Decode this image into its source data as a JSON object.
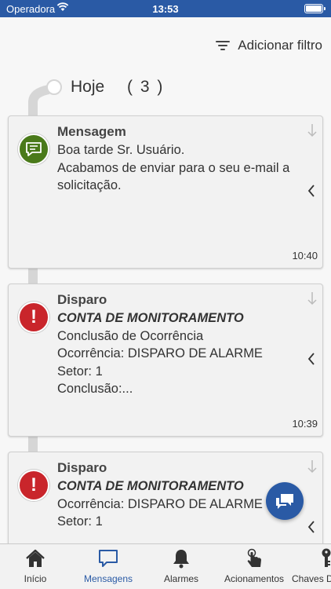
{
  "status_bar": {
    "carrier": "Operadora",
    "time": "13:53"
  },
  "toolbar": {
    "filter_label": "Adicionar filtro"
  },
  "timeline": {
    "day_label": "Hoje",
    "day_count": "( 3 )"
  },
  "messages": [
    {
      "title": "Mensagem",
      "subtitle": "",
      "lines": [
        "Boa tarde Sr. Usuário.",
        "Acabamos de enviar para o seu e-mail a solicitação."
      ],
      "time": "10:40",
      "icon": "chat-bubble-icon",
      "color": "#4a7a1a"
    },
    {
      "title": "Disparo",
      "subtitle": "CONTA DE MONITORAMENTO",
      "lines": [
        "Conclusão de Ocorrência",
        "Ocorrência: DISPARO DE ALARME",
        "Setor: 1",
        "Conclusão:..."
      ],
      "time": "10:39",
      "icon": "exclamation-icon",
      "color": "#c9252b"
    },
    {
      "title": "Disparo",
      "subtitle": "CONTA DE MONITORAMENTO",
      "lines": [
        "Ocorrência: DISPARO DE ALARME",
        "Setor: 1"
      ],
      "time": "",
      "icon": "exclamation-icon",
      "color": "#c9252b"
    }
  ],
  "tabs": [
    {
      "label": "Início",
      "icon": "home-icon",
      "active": false
    },
    {
      "label": "Mensagens",
      "icon": "chat-icon",
      "active": true
    },
    {
      "label": "Alarmes",
      "icon": "bell-icon",
      "active": false
    },
    {
      "label": "Acionamentos",
      "icon": "tap-icon",
      "active": false
    },
    {
      "label": "Chaves D",
      "icon": "key-icon",
      "active": false
    }
  ],
  "colors": {
    "accent": "#2a5aa5",
    "message_green": "#4a7a1a",
    "alert_red": "#c9252b"
  }
}
